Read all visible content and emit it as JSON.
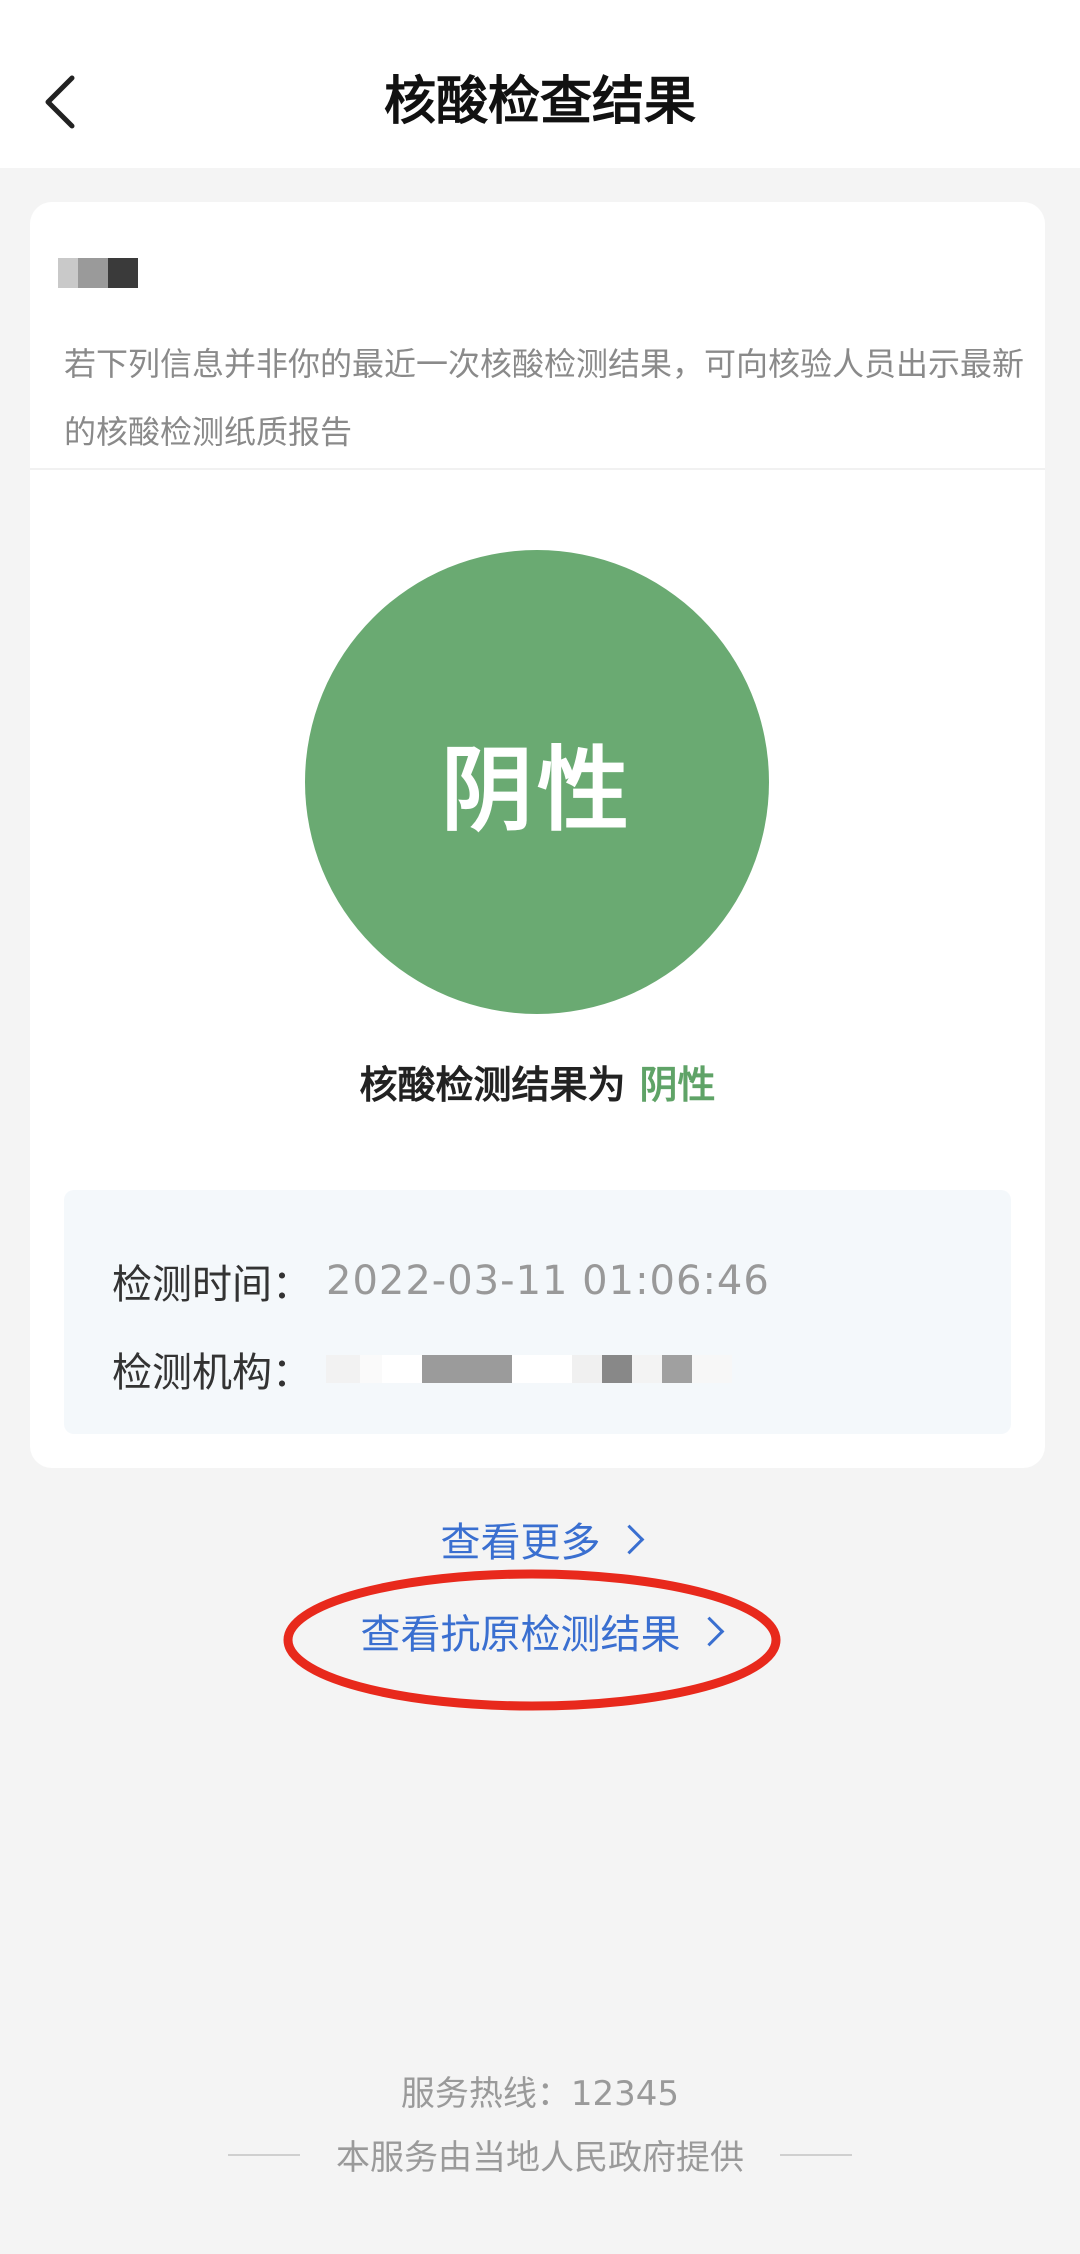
{
  "nav": {
    "title": "核酸检查结果"
  },
  "card": {
    "notice": "若下列信息并非你的最近一次核酸检测结果，可向核验人员出示最新的核酸检测纸质报告",
    "circle_text": "阴性",
    "result_prefix": "核酸检测结果为",
    "result_value": "阴性",
    "detail": {
      "time_label": "检测时间：",
      "time_value": "2022-03-11 01:06:46",
      "org_label": "检测机构："
    }
  },
  "links": {
    "more": "查看更多",
    "antigen": "查看抗原检测结果"
  },
  "footer": {
    "hotline": "服务热线：12345",
    "note": "本服务由当地人民政府提供"
  },
  "colors": {
    "positive_green": "#6aaa72",
    "link_blue": "#3a6fd0",
    "highlight_red": "#e8291c"
  }
}
